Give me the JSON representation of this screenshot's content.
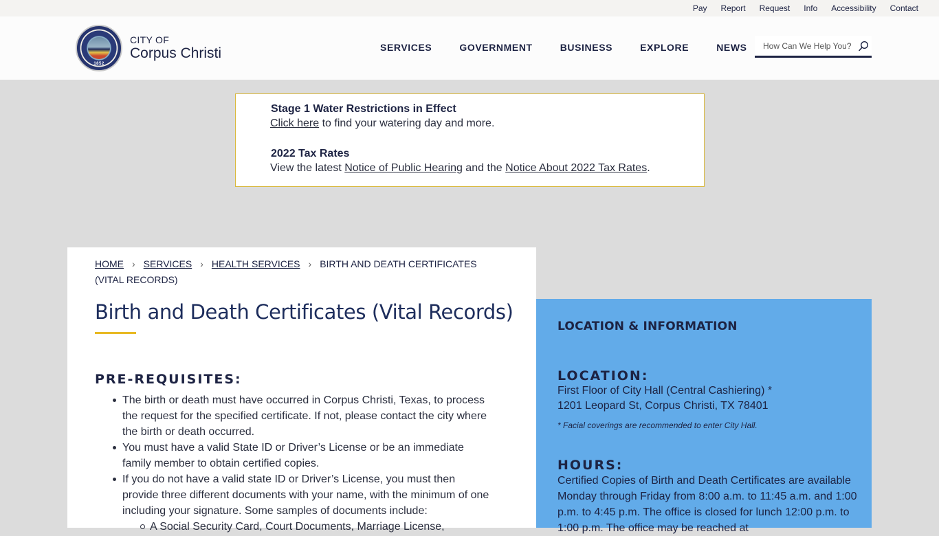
{
  "utility_nav": [
    "Pay",
    "Report",
    "Request",
    "Info",
    "Accessibility",
    "Contact"
  ],
  "header": {
    "logo_small": "CITY OF",
    "logo_big": "Corpus Christi",
    "seal_year": "1852",
    "nav": [
      "SERVICES",
      "GOVERNMENT",
      "BUSINESS",
      "EXPLORE",
      "NEWS"
    ],
    "search_placeholder": "How Can We Help You?"
  },
  "alert": {
    "items": [
      {
        "title": "Stage 1 Water Restrictions in Effect",
        "link_text": "Click here",
        "rest": " to find your watering day and more."
      },
      {
        "title": "2022 Tax Rates",
        "prefix": "View the latest ",
        "link1": "Notice of Public Hearing",
        "middle": " and the ",
        "link2": "Notice About 2022 Tax Rates",
        "suffix": "."
      }
    ]
  },
  "breadcrumb": {
    "items": [
      "HOME",
      "SERVICES",
      "HEALTH SERVICES"
    ],
    "current": "BIRTH AND DEATH CERTIFICATES (VITAL RECORDS)",
    "separator": "›"
  },
  "main": {
    "title": "Birth and Death Certificates (Vital Records)",
    "section_heading": "PRE-REQUISITES:",
    "prereqs": [
      "The birth or death must have occurred in Corpus Christi, Texas, to process the request for the specified certificate. If not, please contact the city where the birth or death occurred.",
      "You must have a valid State ID or Driver’s License or be an immediate family member to obtain certified copies.",
      "If you do not have a valid state ID or Driver’s License, you must then provide three different documents with your name, with the minimum of one including your signature. Some samples of documents include:"
    ],
    "sub_items": [
      "A Social Security Card, Court Documents, Marriage License,"
    ]
  },
  "sidebar": {
    "title": "LOCATION & INFORMATION",
    "location_heading": "LOCATION:",
    "location_line1": "First Floor of City Hall (Central Cashiering) *",
    "location_line2": "1201 Leopard St, Corpus Christi, TX 78401",
    "location_note": "* Facial coverings are recommended to enter City Hall.",
    "hours_heading": "HOURS:",
    "hours_text": "Certified Copies of Birth and Death Certificates are available Monday through Friday from 8:00 a.m. to 11:45 a.m. and 1:00 p.m. to 4:45 p.m. The office is closed for lunch 12:00 p.m. to 1:00 p.m. The office may be reached at"
  },
  "colors": {
    "navy": "#1d2343",
    "accent_gold": "#e8b923",
    "sidebar_blue": "#62abe9",
    "page_gray": "#dcdcdc"
  }
}
